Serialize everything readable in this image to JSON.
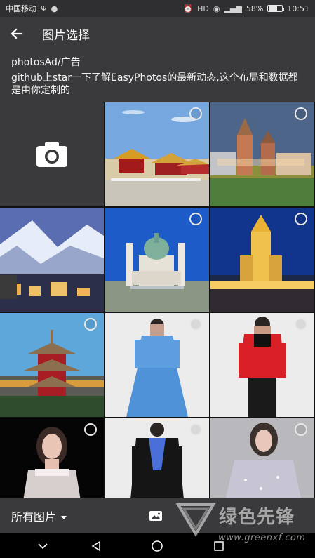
{
  "status": {
    "carrier": "中国移动",
    "battery_percent": 58,
    "battery_text": "58%",
    "time": "10:51",
    "icons": [
      "usb-icon",
      "chat-icon",
      "alarm-icon",
      "hd-icon",
      "eye-icon",
      "signal-icon",
      "battery-icon"
    ]
  },
  "header": {
    "title": "图片选择",
    "back_icon": "arrow-left-icon"
  },
  "ad": {
    "title": "photosAd/广告",
    "description": "github上star一下了解EasyPhotos的最新动态,这个布局和数据都是由你定制的"
  },
  "grid": {
    "first_tile_icon": "camera-icon",
    "photos": [
      {
        "name": "forbidden-city"
      },
      {
        "name": "castle-hill"
      },
      {
        "name": "snowy-village"
      },
      {
        "name": "baroque-church"
      },
      {
        "name": "night-tower"
      },
      {
        "name": "red-pagoda"
      },
      {
        "name": "blue-dress"
      },
      {
        "name": "red-suit"
      },
      {
        "name": "white-top-woman"
      },
      {
        "name": "black-jacket"
      },
      {
        "name": "sparkly-dress"
      }
    ]
  },
  "footer": {
    "album_label": "所有图片",
    "album_icon": "caret-down-icon",
    "preview_icon": "image-icon"
  },
  "navbar": {
    "icons": [
      "chevron-down-icon",
      "back-triangle-icon",
      "home-circle-icon",
      "recent-square-icon"
    ]
  },
  "watermark": {
    "text": "绿色先锋",
    "url": "www.greenxf.com"
  },
  "colors": {
    "background": "#3a3a3c",
    "status_bar": "#2f2f31",
    "nav_bar": "#000000",
    "accent_red": "#d81f26",
    "accent_blue": "#4a90e2"
  }
}
